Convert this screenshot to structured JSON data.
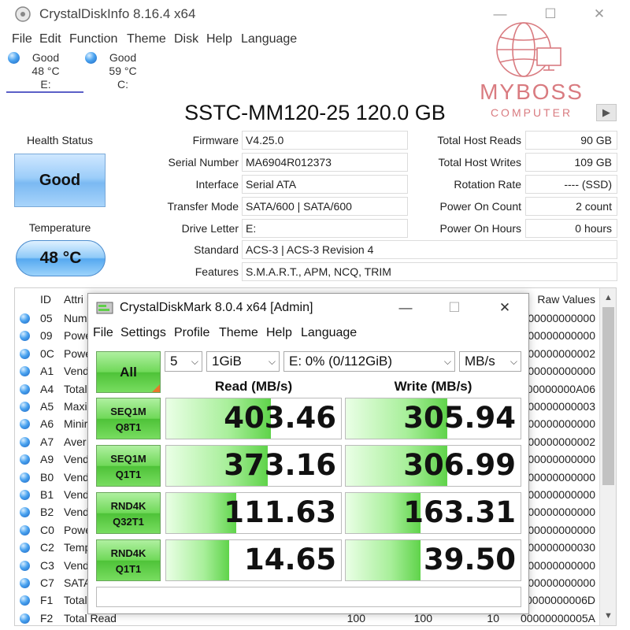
{
  "cdi": {
    "title": "CrystalDiskInfo 8.16.4 x64",
    "controls": {
      "minimize": "—",
      "maximize": "☐",
      "close": "✕"
    },
    "menu": [
      "File",
      "Edit",
      "Function",
      "Theme",
      "Disk",
      "Help",
      "Language"
    ],
    "disks": [
      {
        "status": "Good",
        "temp": "48 °C",
        "letter": "E:"
      },
      {
        "status": "Good",
        "temp": "59 °C",
        "letter": "C:"
      }
    ],
    "drive_title": "SSTC-MM120-25 120.0 GB",
    "nav_glyph": "▶",
    "health_label": "Health Status",
    "health_value": "Good",
    "temp_label": "Temperature",
    "temp_value": "48 °C",
    "left_info": [
      {
        "label": "Firmware",
        "value": "V4.25.0"
      },
      {
        "label": "Serial Number",
        "value": "MA6904R012373"
      },
      {
        "label": "Interface",
        "value": "Serial ATA"
      },
      {
        "label": "Transfer Mode",
        "value": "SATA/600 | SATA/600"
      },
      {
        "label": "Drive Letter",
        "value": "E:"
      }
    ],
    "right_info": [
      {
        "label": "Total Host Reads",
        "value": "90 GB"
      },
      {
        "label": "Total Host Writes",
        "value": "109 GB"
      },
      {
        "label": "Rotation Rate",
        "value": "---- (SSD)"
      },
      {
        "label": "Power On Count",
        "value": "2 count"
      },
      {
        "label": "Power On Hours",
        "value": "0 hours"
      }
    ],
    "standard": {
      "label": "Standard",
      "value": "ACS-3 | ACS-3 Revision 4"
    },
    "features": {
      "label": "Features",
      "value": "S.M.A.R.T., APM, NCQ, TRIM"
    },
    "smart": {
      "headers": {
        "id": "ID",
        "attribute": "Attri",
        "raw": "Raw Values"
      },
      "rows": [
        {
          "id": "05",
          "attr": "Num",
          "raw": "000000000000"
        },
        {
          "id": "09",
          "attr": "Powe",
          "raw": "000000000000"
        },
        {
          "id": "0C",
          "attr": "Powe",
          "raw": "000000000002"
        },
        {
          "id": "A1",
          "attr": "Vend",
          "raw": "000000000000"
        },
        {
          "id": "A4",
          "attr": "Total",
          "raw": "000000000A06"
        },
        {
          "id": "A5",
          "attr": "Maxi",
          "raw": "000000000003"
        },
        {
          "id": "A6",
          "attr": "Minir",
          "raw": "000000000000"
        },
        {
          "id": "A7",
          "attr": "Aver",
          "raw": "000000000002"
        },
        {
          "id": "A9",
          "attr": "Vend",
          "raw": "000000000000"
        },
        {
          "id": "B0",
          "attr": "Vend",
          "raw": "000000000000"
        },
        {
          "id": "B1",
          "attr": "Vend",
          "raw": "000000000000"
        },
        {
          "id": "B2",
          "attr": "Vend",
          "raw": "000000000000"
        },
        {
          "id": "C0",
          "attr": "Powe",
          "raw": "000000000000"
        },
        {
          "id": "C2",
          "attr": "Temp",
          "raw": "000000000030"
        },
        {
          "id": "C3",
          "attr": "Vend",
          "raw": "000000000000"
        },
        {
          "id": "C7",
          "attr": "SATA",
          "raw": "000000000000"
        },
        {
          "id": "F1",
          "attr": "Total",
          "raw": "00000000006D"
        },
        {
          "id": "F2",
          "attr": "Total Read",
          "c1": "100",
          "c2": "100",
          "c3": "10",
          "raw": "00000000005A"
        }
      ]
    },
    "scroll": {
      "up": "▲",
      "down": "▼"
    }
  },
  "logo": {
    "name": "MYBOSS",
    "sub": "COMPUTER"
  },
  "cdm": {
    "title": "CrystalDiskMark 8.0.4 x64 [Admin]",
    "controls": {
      "minimize": "—",
      "maximize": "☐",
      "close": "✕"
    },
    "menu": [
      "File",
      "Settings",
      "Profile",
      "Theme",
      "Help",
      "Language"
    ],
    "all_label": "All",
    "count": "5",
    "size": "1GiB",
    "drive": "E: 0% (0/112GiB)",
    "unit": "MB/s",
    "chevron": "⌵",
    "read_header": "Read (MB/s)",
    "write_header": "Write (MB/s)",
    "tests": [
      {
        "l1": "SEQ1M",
        "l2": "Q8T1",
        "read": "403.46",
        "write": "305.94"
      },
      {
        "l1": "SEQ1M",
        "l2": "Q1T1",
        "read": "373.16",
        "write": "306.99"
      },
      {
        "l1": "RND4K",
        "l2": "Q32T1",
        "read": "111.63",
        "write": "163.31"
      },
      {
        "l1": "RND4K",
        "l2": "Q1T1",
        "read": "14.65",
        "write": "39.50"
      }
    ],
    "bar_fill": {
      "read": [
        0.6,
        0.58,
        0.4,
        0.36
      ],
      "write": [
        0.58,
        0.58,
        0.43,
        0.43
      ]
    }
  }
}
